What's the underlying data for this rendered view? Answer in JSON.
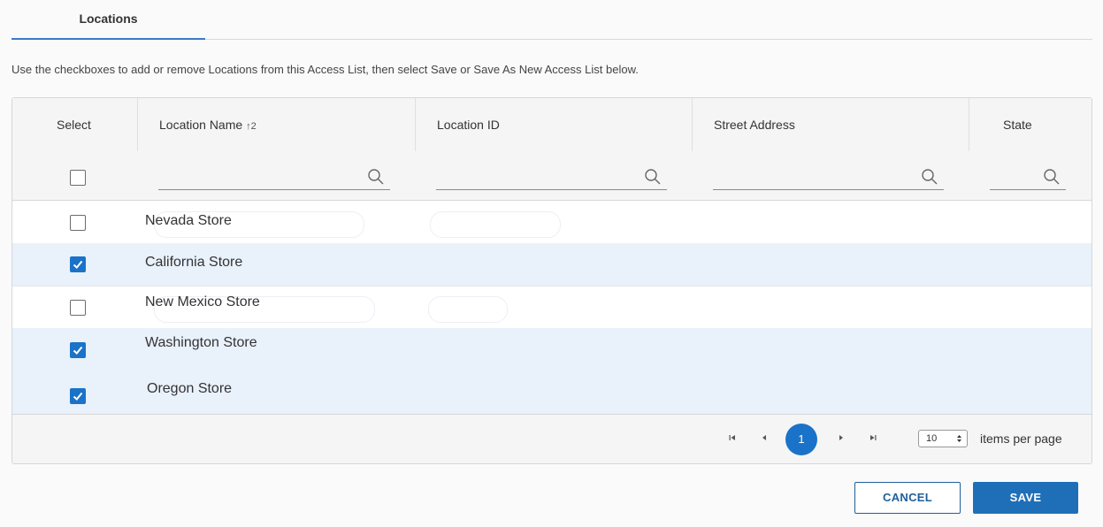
{
  "tabs": [
    {
      "label": "Locations",
      "active": true
    }
  ],
  "instructions": "Use the checkboxes to add or remove Locations from this Access List, then select Save or Save As New Access List below.",
  "grid": {
    "columns": [
      {
        "label": "Select"
      },
      {
        "label": "Location Name",
        "sort": "↑2"
      },
      {
        "label": "Location ID"
      },
      {
        "label": "Street Address"
      },
      {
        "label": "State"
      }
    ],
    "filters": {
      "location_name": "",
      "location_id": "",
      "street_address": "",
      "state": ""
    },
    "select_all_checked": false,
    "rows": [
      {
        "name": "Nevada Store",
        "checked": false
      },
      {
        "name": "California Store",
        "checked": true
      },
      {
        "name": "New Mexico Store",
        "checked": false
      },
      {
        "name": "Washington Store",
        "checked": true
      },
      {
        "name": "Oregon Store",
        "checked": true
      }
    ]
  },
  "pager": {
    "current_page": "1",
    "page_size": "10",
    "items_per_page_label": "items per page"
  },
  "buttons": {
    "cancel": "CANCEL",
    "save": "SAVE"
  },
  "colors": {
    "accent": "#1a73c8",
    "selected_row": "#e9f1fb",
    "save_button": "#1f6fb8"
  }
}
